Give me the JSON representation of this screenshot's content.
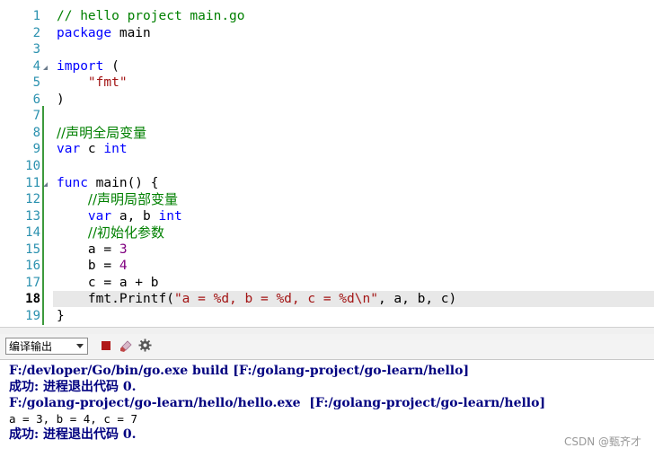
{
  "editor": {
    "line_numbers": [
      "1",
      "2",
      "3",
      "4",
      "5",
      "6",
      "7",
      "8",
      "9",
      "10",
      "11",
      "12",
      "13",
      "14",
      "15",
      "16",
      "17",
      "18",
      "19"
    ],
    "current_line": "18",
    "fold_lines": [
      "4",
      "11"
    ],
    "lines": [
      [
        {
          "t": "// hello project main.go",
          "c": "cm"
        }
      ],
      [
        {
          "t": "package",
          "c": "kw"
        },
        {
          "t": " main",
          "c": ""
        }
      ],
      [],
      [
        {
          "t": "import",
          "c": "kw"
        },
        {
          "t": " (",
          "c": ""
        }
      ],
      [
        {
          "t": "    ",
          "c": ""
        },
        {
          "t": "\"fmt\"",
          "c": "st"
        }
      ],
      [
        {
          "t": ")",
          "c": ""
        }
      ],
      [],
      [
        {
          "t": "//声明全局变量",
          "c": "cm cjk"
        }
      ],
      [
        {
          "t": "var",
          "c": "kw"
        },
        {
          "t": " c ",
          "c": ""
        },
        {
          "t": "int",
          "c": "kw"
        }
      ],
      [],
      [
        {
          "t": "func",
          "c": "kw"
        },
        {
          "t": " main() {",
          "c": ""
        }
      ],
      [
        {
          "t": "    ",
          "c": ""
        },
        {
          "t": "//声明局部变量",
          "c": "cm cjk"
        }
      ],
      [
        {
          "t": "    ",
          "c": ""
        },
        {
          "t": "var",
          "c": "kw"
        },
        {
          "t": " a, b ",
          "c": ""
        },
        {
          "t": "int",
          "c": "kw"
        }
      ],
      [
        {
          "t": "    ",
          "c": ""
        },
        {
          "t": "//初始化参数",
          "c": "cm cjk"
        }
      ],
      [
        {
          "t": "    a = ",
          "c": ""
        },
        {
          "t": "3",
          "c": "nm"
        }
      ],
      [
        {
          "t": "    b = ",
          "c": ""
        },
        {
          "t": "4",
          "c": "nm"
        }
      ],
      [
        {
          "t": "    c = a + b",
          "c": ""
        }
      ],
      [
        {
          "t": "    fmt.Printf(",
          "c": ""
        },
        {
          "t": "\"a = %d, b = %d, c = %d\\n\"",
          "c": "st"
        },
        {
          "t": ", a, b, c)",
          "c": ""
        }
      ],
      [
        {
          "t": "}",
          "c": ""
        }
      ]
    ]
  },
  "toolbar": {
    "output_select_value": "编译输出",
    "stop_icon": "stop-icon",
    "clear_icon": "clear-brush-icon",
    "settings_icon": "gear-icon"
  },
  "output": {
    "lines": [
      "F:/devloper/Go/bin/go.exe build [F:/golang-project/go-learn/hello]",
      "成功: 进程退出代码 0.",
      "F:/golang-project/go-learn/hello/hello.exe  [F:/golang-project/go-learn/hello]",
      "a = 3, b = 4, c = 7",
      "成功: 进程退出代码 0."
    ],
    "watermark": "CSDN @甄齐才"
  },
  "colors": {
    "line_number": "#2b91af",
    "keyword": "#0000ff",
    "comment": "#008000",
    "string": "#a31515",
    "number": "#800080",
    "output_text": "#000080",
    "current_line_bg": "#e8e8e8",
    "change_bar": "#3c9a3c"
  }
}
